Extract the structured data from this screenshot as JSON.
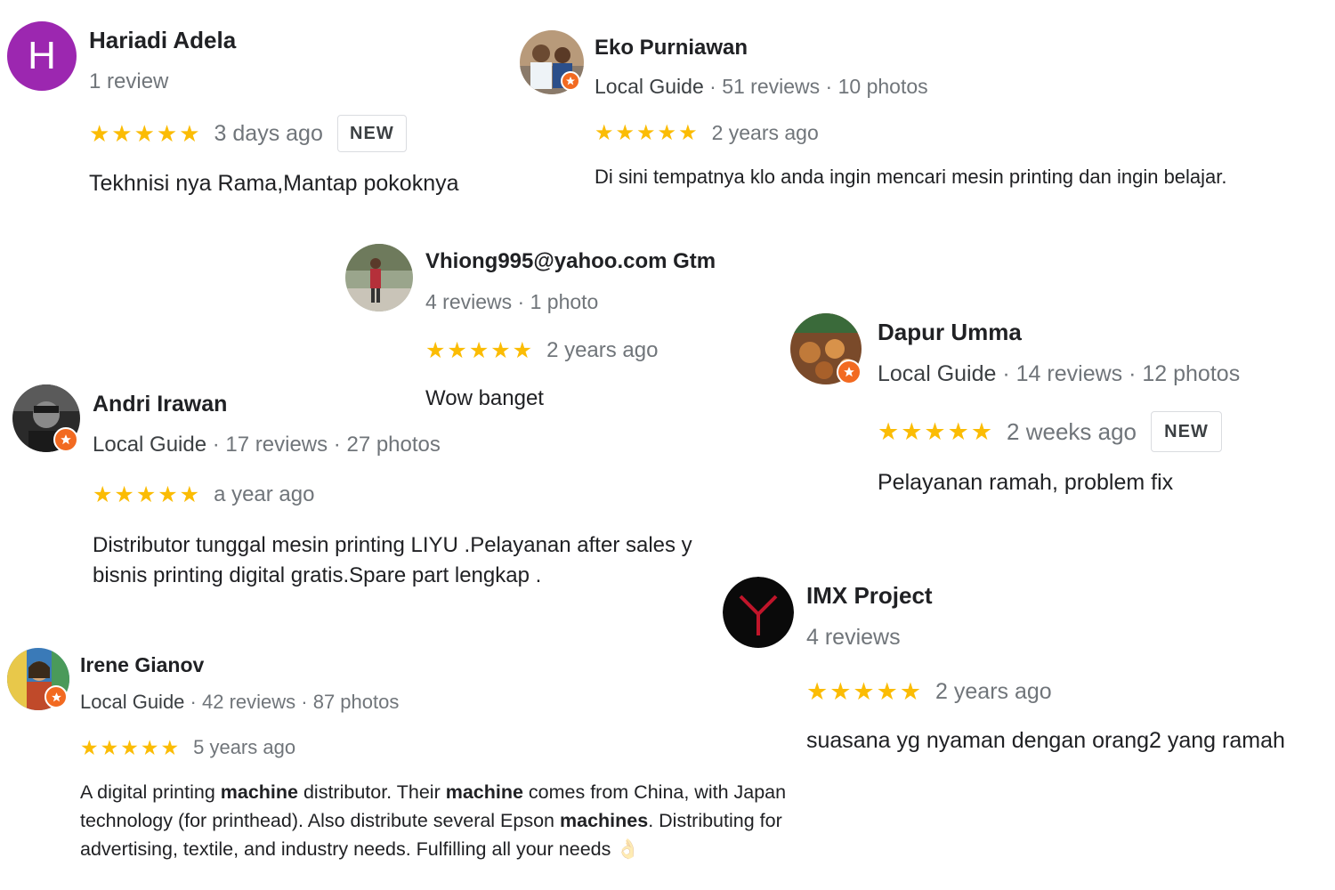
{
  "colors": {
    "star": "#fbbc04",
    "guide_badge": "#f26a21",
    "avatar_purple": "#9c27b0"
  },
  "reviews": [
    {
      "name": "Hariadi Adela",
      "avatar_letter": "H",
      "meta": {
        "count": "1 review"
      },
      "stars": "★★★★★",
      "date": "3 days ago",
      "new": "NEW",
      "text": "Tekhnisi nya Rama,Mantap pokoknya"
    },
    {
      "name": "Eko Purniawan",
      "meta": {
        "guide": "Local Guide",
        "sep1": " · ",
        "count": "51 reviews",
        "sep2": " · ",
        "photos": "10 photos"
      },
      "stars": "★★★★★",
      "date": "2 years ago",
      "text": "Di sini tempatnya klo anda ingin mencari mesin printing dan ingin belajar."
    },
    {
      "name": "Vhiong995@yahoo.com Gtm",
      "meta": {
        "count": "4 reviews",
        "sep1": " · ",
        "photos": "1 photo"
      },
      "stars": "★★★★★",
      "date": "2 years ago",
      "text": "Wow banget"
    },
    {
      "name": "Dapur Umma",
      "meta": {
        "guide": "Local Guide",
        "sep1": " · ",
        "count": "14 reviews",
        "sep2": " · ",
        "photos": "12 photos"
      },
      "stars": "★★★★★",
      "date": "2 weeks ago",
      "new": "NEW",
      "text": "Pelayanan ramah, problem fix"
    },
    {
      "name": "Andri Irawan",
      "meta": {
        "guide": "Local Guide",
        "sep1": " · ",
        "count": "17 reviews",
        "sep2": " · ",
        "photos": "27 photos"
      },
      "stars": "★★★★★",
      "date": "a year ago",
      "text_line1": "Distributor tunggal mesin printing LIYU .Pelayanan after sales y",
      "text_line2": "bisnis printing digital gratis.Spare part lengkap ."
    },
    {
      "name": "IMX Project",
      "meta": {
        "count": "4 reviews"
      },
      "stars": "★★★★★",
      "date": "2 years ago",
      "text": "suasana yg nyaman dengan orang2 yang ramah"
    },
    {
      "name": "Irene Gianov",
      "meta": {
        "guide": "Local Guide",
        "sep1": " · ",
        "count": "42 reviews",
        "sep2": " · ",
        "photos": "87 photos"
      },
      "stars": "★★★★★",
      "date": "5 years ago",
      "text_parts": [
        "A digital printing ",
        "machine",
        " distributor. Their ",
        "machine",
        " comes from China, with Japan",
        "technology (for printhead). Also distribute several Epson ",
        "machines",
        ". Distributing for",
        "advertising, textile, and industry needs. Fulfilling all your needs",
        "👌"
      ]
    }
  ]
}
